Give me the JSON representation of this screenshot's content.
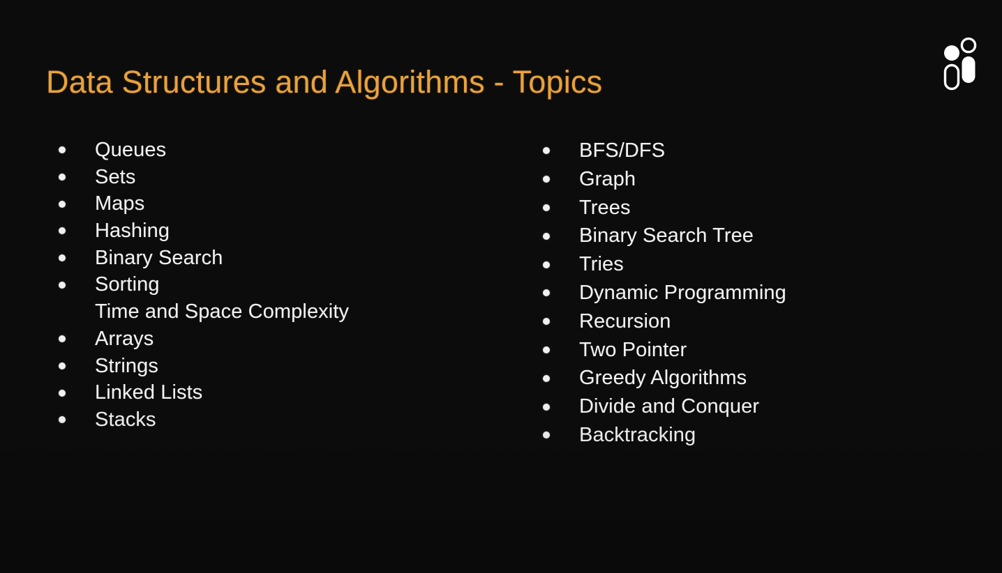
{
  "slide": {
    "title": "Data Structures and Algorithms - Topics",
    "background_color": "#0c0c0c",
    "title_color": "#e9a23c",
    "text_color": "#f2f2f2",
    "bullet_color": "#f0f0f0"
  },
  "logo": {
    "name": "two-figures-logo",
    "color": "#ffffff"
  },
  "columns": {
    "left": {
      "items": [
        {
          "label": "Queues",
          "bullet": true
        },
        {
          "label": "Sets",
          "bullet": true
        },
        {
          "label": "Maps",
          "bullet": true
        },
        {
          "label": "Hashing",
          "bullet": true
        },
        {
          "label": "Binary Search",
          "bullet": true
        },
        {
          "label": "Sorting",
          "bullet": true
        },
        {
          "label": "Time and Space Complexity",
          "bullet": false
        },
        {
          "label": "Arrays",
          "bullet": true
        },
        {
          "label": "Strings",
          "bullet": true
        },
        {
          "label": "Linked Lists",
          "bullet": true
        },
        {
          "label": "Stacks",
          "bullet": true
        }
      ]
    },
    "right": {
      "items": [
        {
          "label": "BFS/DFS",
          "bullet": true
        },
        {
          "label": "Graph",
          "bullet": true
        },
        {
          "label": "Trees",
          "bullet": true
        },
        {
          "label": "Binary Search Tree",
          "bullet": true
        },
        {
          "label": "Tries",
          "bullet": true
        },
        {
          "label": "Dynamic Programming",
          "bullet": true
        },
        {
          "label": "Recursion",
          "bullet": true
        },
        {
          "label": "Two Pointer",
          "bullet": true
        },
        {
          "label": "Greedy Algorithms",
          "bullet": true
        },
        {
          "label": "Divide and Conquer",
          "bullet": true
        },
        {
          "label": "Backtracking",
          "bullet": true
        }
      ]
    }
  }
}
